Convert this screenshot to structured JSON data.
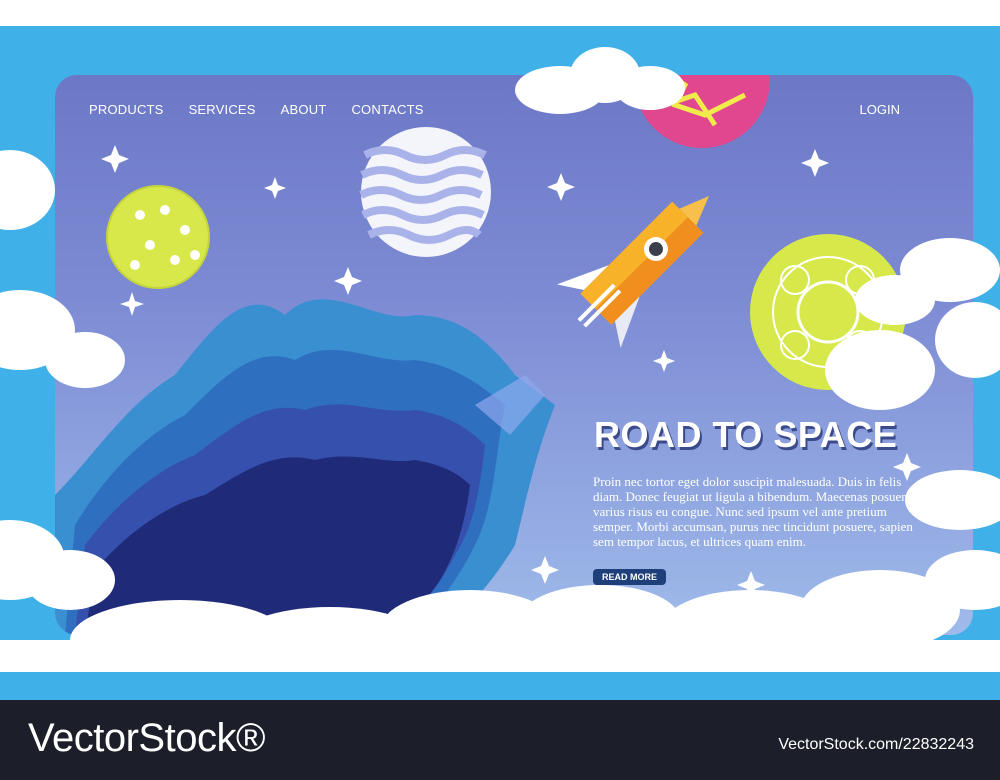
{
  "nav": {
    "items": [
      "PRODUCTS",
      "SERVICES",
      "ABOUT",
      "CONTACTS"
    ],
    "login_label": "LOGIN"
  },
  "hero": {
    "title": "ROAD TO SPACE",
    "body": "Proin nec tortor eget dolor suscipit malesuada. Duis in felis diam. Donec feugiat ut ligula a bibendum. Maecenas posuere varius risus eu congue. Nunc sed ipsum vel ante pretium semper. Morbi accumsan, purus nec tincidunt posuere, sapien sem tempor lacus, et ultrices quam enim.",
    "cta_label": "READ MORE"
  },
  "watermark": {
    "brand": "VectorStock®",
    "image_id": "VectorStock.com/22832243"
  },
  "colors": {
    "sky": "#3fb0e8",
    "card_top": "#6c78c6",
    "card_bottom": "#9fbbea",
    "rocket": "#f7b22a",
    "planet_pink": "#e0478f",
    "planet_lime": "#d8e84a",
    "cta": "#1f3f7a"
  },
  "icons": [
    "rocket-icon",
    "star-icon",
    "planet-icon",
    "cloud-icon"
  ]
}
